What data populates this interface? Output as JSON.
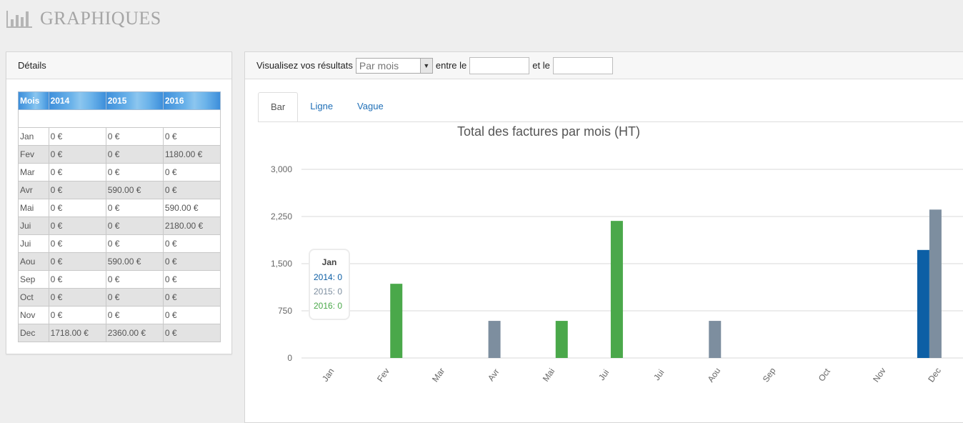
{
  "header": {
    "title": "GRAPHIQUES",
    "icon": "bar-chart-icon"
  },
  "details": {
    "title": "Détails",
    "columns": [
      "Mois",
      "2014",
      "2015",
      "2016"
    ],
    "rows": [
      [
        "Jan",
        "0 €",
        "0 €",
        "0 €"
      ],
      [
        "Fev",
        "0 €",
        "0 €",
        "1180.00 €"
      ],
      [
        "Mar",
        "0 €",
        "0 €",
        "0 €"
      ],
      [
        "Avr",
        "0 €",
        "590.00 €",
        "0 €"
      ],
      [
        "Mai",
        "0 €",
        "0 €",
        "590.00 €"
      ],
      [
        "Jui",
        "0 €",
        "0 €",
        "2180.00 €"
      ],
      [
        "Jui",
        "0 €",
        "0 €",
        "0 €"
      ],
      [
        "Aou",
        "0 €",
        "590.00 €",
        "0 €"
      ],
      [
        "Sep",
        "0 €",
        "0 €",
        "0 €"
      ],
      [
        "Oct",
        "0 €",
        "0 €",
        "0 €"
      ],
      [
        "Nov",
        "0 €",
        "0 €",
        "0 €"
      ],
      [
        "Dec",
        "1718.00 €",
        "2360.00 €",
        "0 €"
      ]
    ]
  },
  "toolbar": {
    "label": "Visualisez vos résultats",
    "period_select": "Par mois",
    "between_label": "entre le",
    "and_label": "et le",
    "start_date": "",
    "end_date": ""
  },
  "tabs": [
    {
      "label": "Bar",
      "active": true
    },
    {
      "label": "Ligne",
      "active": false
    },
    {
      "label": "Vague",
      "active": false
    }
  ],
  "tooltip": {
    "title": "Jan",
    "rows": [
      {
        "label": "2014: 0",
        "color": "#0d5fa5"
      },
      {
        "label": "2015: 0",
        "color": "#7d8e9f"
      },
      {
        "label": "2016: 0",
        "color": "#4aa84a"
      }
    ]
  },
  "chart_data": {
    "type": "bar",
    "title": "Total des factures par mois (HT)",
    "categories": [
      "Jan",
      "Fev",
      "Mar",
      "Avr",
      "Mai",
      "Jui",
      "Jui",
      "Aou",
      "Sep",
      "Oct",
      "Nov",
      "Dec"
    ],
    "series": [
      {
        "name": "2014",
        "color": "#0d5fa5",
        "values": [
          0,
          0,
          0,
          0,
          0,
          0,
          0,
          0,
          0,
          0,
          0,
          1718
        ]
      },
      {
        "name": "2015",
        "color": "#7d8e9f",
        "values": [
          0,
          0,
          0,
          590,
          0,
          0,
          0,
          590,
          0,
          0,
          0,
          2360
        ]
      },
      {
        "name": "2016",
        "color": "#4aa84a",
        "values": [
          0,
          1180,
          0,
          0,
          590,
          2180,
          0,
          0,
          0,
          0,
          0,
          0
        ]
      }
    ],
    "ylim": [
      0,
      3000
    ],
    "yticks": [
      "0",
      "750",
      "1,500",
      "2,250",
      "3,000"
    ],
    "grid": true
  }
}
